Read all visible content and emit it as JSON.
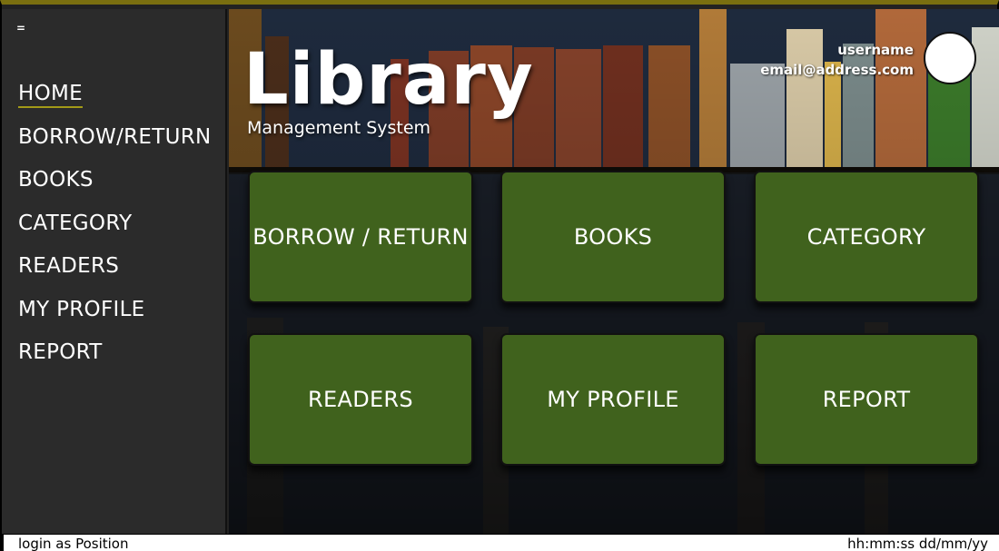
{
  "sidebar": {
    "toggle_label": "=",
    "items": [
      {
        "label": "HOME",
        "active": true
      },
      {
        "label": "BORROW/RETURN",
        "active": false
      },
      {
        "label": "BOOKS",
        "active": false
      },
      {
        "label": "CATEGORY",
        "active": false
      },
      {
        "label": "READERS",
        "active": false
      },
      {
        "label": "MY PROFILE",
        "active": false
      },
      {
        "label": "REPORT",
        "active": false
      }
    ]
  },
  "header": {
    "title": "Library",
    "subtitle": "Management System",
    "user": {
      "name": "username",
      "email": "email@address.com"
    }
  },
  "tiles": [
    {
      "label": "BORROW / RETURN"
    },
    {
      "label": "BOOKS"
    },
    {
      "label": "CATEGORY"
    },
    {
      "label": "READERS"
    },
    {
      "label": "MY PROFILE"
    },
    {
      "label": "REPORT"
    }
  ],
  "status": {
    "login_text": "login as Position",
    "datetime": "hh:mm:ss dd/mm/yy"
  },
  "colors": {
    "accent_bar": "#7a6f10",
    "tile_green": "#40621d",
    "sidebar_bg": "#2b2b2b"
  }
}
